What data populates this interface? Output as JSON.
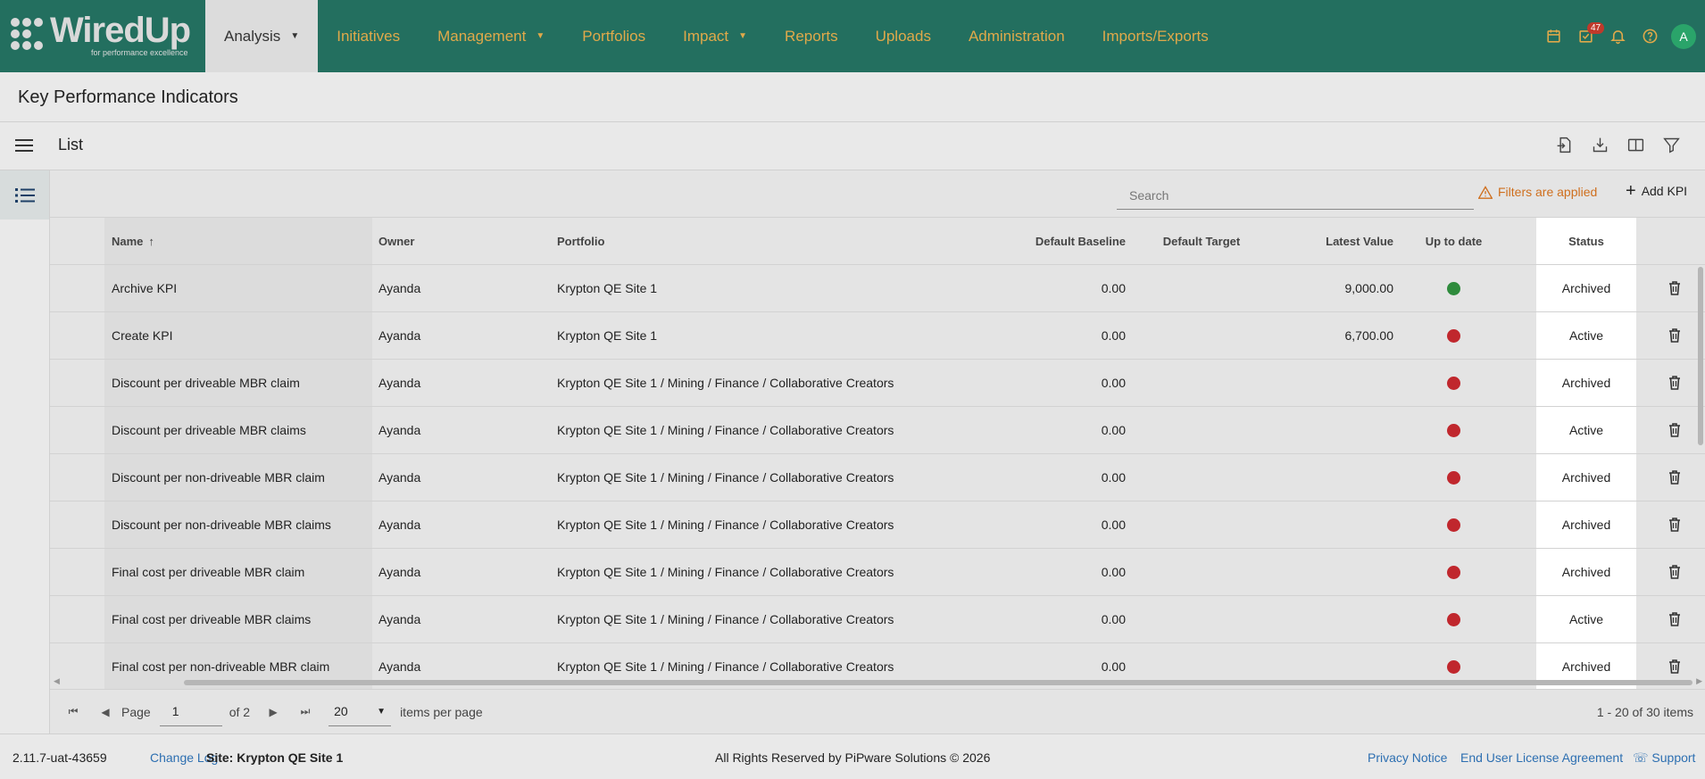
{
  "brand": {
    "name": "WiredUp",
    "tagline": "for performance excellence"
  },
  "nav": [
    {
      "label": "Analysis",
      "caret": "▼"
    },
    {
      "label": "Initiatives",
      "caret": ""
    },
    {
      "label": "Management",
      "caret": "▼"
    },
    {
      "label": "Portfolios",
      "caret": ""
    },
    {
      "label": "Impact",
      "caret": "▼"
    },
    {
      "label": "Reports",
      "caret": ""
    },
    {
      "label": "Uploads",
      "caret": ""
    },
    {
      "label": "Administration",
      "caret": ""
    },
    {
      "label": "Imports/Exports",
      "caret": ""
    }
  ],
  "top_icons": {
    "calendar": "calendar-icon",
    "tasks": "tasks-icon",
    "tasks_badge": "47",
    "bell": "bell-icon",
    "help": "help-icon",
    "avatar": "A"
  },
  "page": {
    "title": "Key Performance Indicators",
    "list_title": "List"
  },
  "toolbar": {
    "search_placeholder": "Search",
    "filters_label": "Filters are applied",
    "add_label": "Add KPI"
  },
  "columns": {
    "name": "Name",
    "sort": "↑",
    "owner": "Owner",
    "portfolio": "Portfolio",
    "baseline": "Default Baseline",
    "target": "Default Target",
    "latest": "Latest Value",
    "uptodate": "Up to date",
    "status": "Status"
  },
  "rows": [
    {
      "name": "Archive KPI",
      "owner": "Ayanda",
      "portfolio": "Krypton QE Site 1",
      "baseline": "0.00",
      "target": "",
      "latest": "9,000.00",
      "uptodate": "green",
      "status": "Archived"
    },
    {
      "name": "Create KPI",
      "owner": "Ayanda",
      "portfolio": "Krypton QE Site 1",
      "baseline": "0.00",
      "target": "",
      "latest": "6,700.00",
      "uptodate": "red",
      "status": "Active"
    },
    {
      "name": "Discount per driveable MBR claim",
      "owner": "Ayanda",
      "portfolio": "Krypton QE Site 1 / Mining / Finance / Collaborative Creators",
      "baseline": "0.00",
      "target": "",
      "latest": "",
      "uptodate": "red",
      "status": "Archived"
    },
    {
      "name": "Discount per driveable MBR claims",
      "owner": "Ayanda",
      "portfolio": "Krypton QE Site 1 / Mining / Finance / Collaborative Creators",
      "baseline": "0.00",
      "target": "",
      "latest": "",
      "uptodate": "red",
      "status": "Active"
    },
    {
      "name": "Discount per non-driveable MBR claim",
      "owner": "Ayanda",
      "portfolio": "Krypton QE Site 1 / Mining / Finance / Collaborative Creators",
      "baseline": "0.00",
      "target": "",
      "latest": "",
      "uptodate": "red",
      "status": "Archived"
    },
    {
      "name": "Discount per non-driveable MBR claims",
      "owner": "Ayanda",
      "portfolio": "Krypton QE Site 1 / Mining / Finance / Collaborative Creators",
      "baseline": "0.00",
      "target": "",
      "latest": "",
      "uptodate": "red",
      "status": "Archived"
    },
    {
      "name": "Final cost per driveable MBR claim",
      "owner": "Ayanda",
      "portfolio": "Krypton QE Site 1 / Mining / Finance / Collaborative Creators",
      "baseline": "0.00",
      "target": "",
      "latest": "",
      "uptodate": "red",
      "status": "Archived"
    },
    {
      "name": "Final cost per driveable MBR claims",
      "owner": "Ayanda",
      "portfolio": "Krypton QE Site 1 / Mining / Finance / Collaborative Creators",
      "baseline": "0.00",
      "target": "",
      "latest": "",
      "uptodate": "red",
      "status": "Active"
    },
    {
      "name": "Final cost per non-driveable MBR claim",
      "owner": "Ayanda",
      "portfolio": "Krypton QE Site 1 / Mining / Finance / Collaborative Creators",
      "baseline": "0.00",
      "target": "",
      "latest": "",
      "uptodate": "red",
      "status": "Archived"
    }
  ],
  "colors": {
    "nav_bg": "#236f5f",
    "nav_text": "#e0a94a",
    "dot_green": "#2e8b3c",
    "dot_red": "#c0272d",
    "warning": "#cf6f1e",
    "link": "#2d6fb1"
  },
  "pager": {
    "page_label": "Page",
    "page_value": "1",
    "of_label": "of 2",
    "page_size": "20",
    "items_label": "items per page",
    "summary": "1 - 20 of 30 items"
  },
  "footer": {
    "version": "2.11.7-uat-43659",
    "changelog": "Change Log",
    "site": "Site: Krypton QE Site 1",
    "rights": "All Rights Reserved by PiPware Solutions © 2026",
    "privacy": "Privacy Notice",
    "eula": "End User License Agreement",
    "support": "Support"
  }
}
